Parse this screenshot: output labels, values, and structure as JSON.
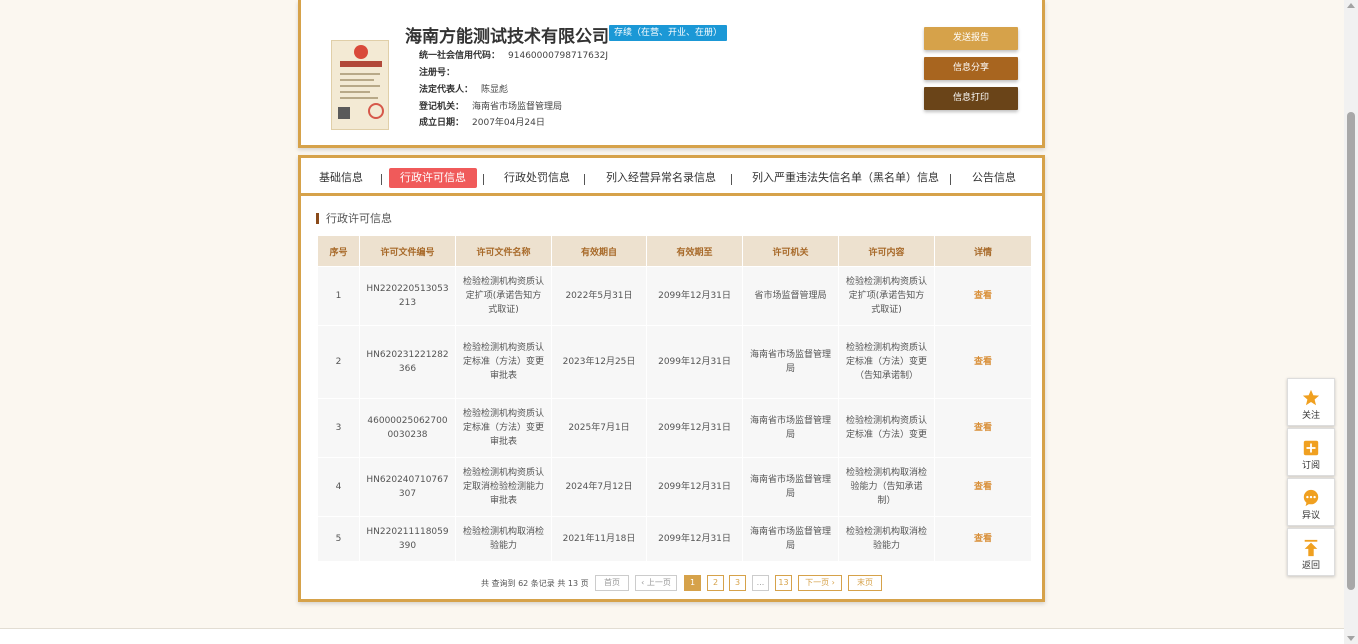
{
  "company": {
    "name": "海南方能测试技术有限公司",
    "status": "存续（在营、开业、在册）",
    "license_image_label": "营业执照",
    "fields": [
      {
        "label": "统一社会信用代码：",
        "value": "91460000798717632J"
      },
      {
        "label": "注册号：",
        "value": ""
      },
      {
        "label": "法定代表人：",
        "value": "陈显彪"
      },
      {
        "label": "登记机关：",
        "value": "海南省市场监督管理局"
      },
      {
        "label": "成立日期：",
        "value": "2007年04月24日"
      }
    ]
  },
  "actions": {
    "send_report": "发送报告",
    "share": "信息分享",
    "print": "信息打印"
  },
  "tabs": [
    "基础信息",
    "行政许可信息",
    "行政处罚信息",
    "列入经营异常名录信息",
    "列入严重违法失信名单（黑名单）信息",
    "公告信息"
  ],
  "active_tab": "行政许可信息",
  "section_title": "行政许可信息",
  "table": {
    "headers": [
      "序号",
      "许可文件编号",
      "许可文件名称",
      "有效期自",
      "有效期至",
      "许可机关",
      "许可内容",
      "详情"
    ],
    "rows": [
      {
        "no": "1",
        "code": "HN220220513053213",
        "name": "检验检测机构资质认定扩项(承诺告知方式取证)",
        "from": "2022年5月31日",
        "to": "2099年12月31日",
        "authority": "省市场监督管理局",
        "content": "检验检测机构资质认定扩项(承诺告知方式取证)",
        "detail": "查看"
      },
      {
        "no": "2",
        "code": "HN620231221282366",
        "name": "检验检测机构资质认定标准（方法）变更审批表",
        "from": "2023年12月25日",
        "to": "2099年12月31日",
        "authority": "海南省市场监督管理局",
        "content": "检验检测机构资质认定标准（方法）变更（告知承诺制）",
        "detail": "查看"
      },
      {
        "no": "3",
        "code": "460000250627000030238",
        "name": "检验检测机构资质认定标准（方法）变更审批表",
        "from": "2025年7月1日",
        "to": "2099年12月31日",
        "authority": "海南省市场监督管理局",
        "content": "检验检测机构资质认定标准（方法）变更",
        "detail": "查看"
      },
      {
        "no": "4",
        "code": "HN620240710767307",
        "name": "检验检测机构资质认定取消检验检测能力审批表",
        "from": "2024年7月12日",
        "to": "2099年12月31日",
        "authority": "海南省市场监督管理局",
        "content": "检验检测机构取消检验能力（告知承诺制）",
        "detail": "查看"
      },
      {
        "no": "5",
        "code": "HN220211118059390",
        "name": "检验检测机构取消检验能力",
        "from": "2021年11月18日",
        "to": "2099年12月31日",
        "authority": "海南省市场监督管理局",
        "content": "检验检测机构取消检验能力",
        "detail": "查看"
      }
    ]
  },
  "pagination": {
    "summary": "共 查询到 62 条记录 共 13 页",
    "first": "首页",
    "prev": "‹ 上一页",
    "pages": [
      "1",
      "2",
      "3",
      "...",
      "13"
    ],
    "current": "1",
    "next": "下一页 ›",
    "last": "末页"
  },
  "float_menu": [
    {
      "label": "关注",
      "icon": "star-icon"
    },
    {
      "label": "订阅",
      "icon": "subscribe-icon"
    },
    {
      "label": "异议",
      "icon": "chat-icon"
    },
    {
      "label": "返回",
      "icon": "back-to-top-icon"
    }
  ],
  "colors": {
    "accent": "#d6a24a",
    "active_tab": "#f05a5a",
    "status_badge": "#1b98d6",
    "share_button": "#a8651f",
    "print_button": "#6a4418"
  }
}
